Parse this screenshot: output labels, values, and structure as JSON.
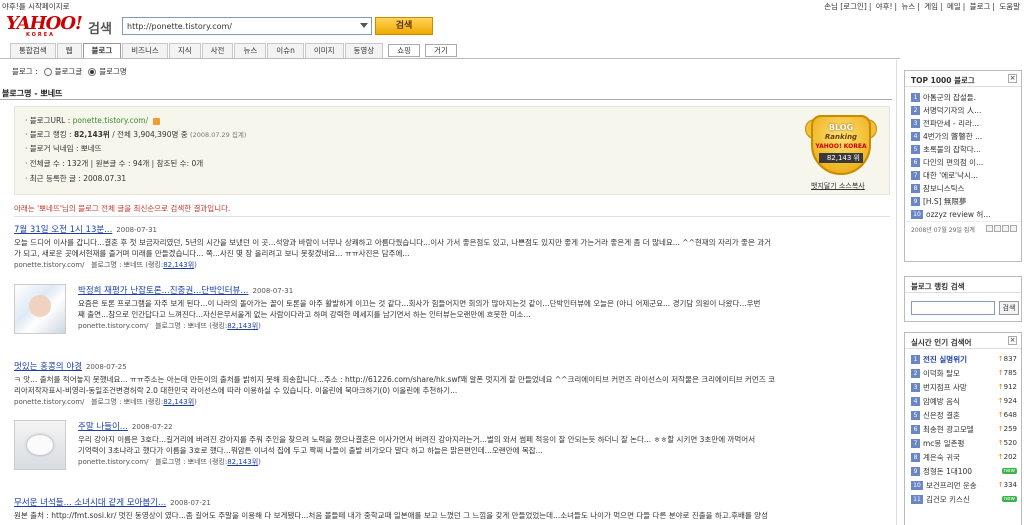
{
  "util": {
    "left_text": "야후!를 시작페이지로",
    "right_items": [
      "손님 [로그인]",
      "야후!",
      "뉴스",
      "게임",
      "메일",
      "블로그",
      "도움말"
    ]
  },
  "header": {
    "logo_text": "YAHOO!",
    "logo_sub": "KOREA",
    "search_label": "검색",
    "search_value": "http://ponette.tistory.com/",
    "search_button": "검색"
  },
  "tabs": [
    "통합검색",
    "웹",
    "블로그",
    "비즈니스",
    "지식",
    "사전",
    "뉴스",
    "이슈n",
    "이미지",
    "동영상",
    "쇼핑",
    "거기"
  ],
  "radio": {
    "label": "블로그 :",
    "opt1": "블로그글",
    "opt2": "블로그명"
  },
  "section_title": "블로그명 - 뽀네뜨",
  "info": {
    "url_label": "블로그URL :",
    "url": "ponette.tistory.com/",
    "rank_label": "블로그 랭킹 :",
    "rank_value": "82,143위",
    "rank_total": "/ 전체 3,904,390명 중",
    "rank_date": "(2008.07.29 집계)",
    "nick_label": "블로거 닉네임 :",
    "nick": "뽀네뜨",
    "counts": "전체글 수 : 132개 | 원본글 수 : 94개 | 참조된 수: 0개",
    "last_label": "최근 등록한 글 :",
    "last_date": "2008.07.31",
    "badge_top": "BLOG",
    "badge_mid": "Ranking",
    "badge_logo": "YAHOO! KOREA",
    "badge_value": "82,143 위",
    "badge_source": "뱃지달기 소스복사"
  },
  "notice": "아래는 '뽀네뜨'님의 블로그 전체 글을 최신순으로 검색한 결과입니다.",
  "results": [
    {
      "title": "7월 31일 오전 1시 13분...",
      "date": "2008-07-31",
      "body1": "오늘 드디어 이사를 갑니다...결혼 후 첫 보금자리였던, 5년의 시간을 보냈던 이 곳...석양과 바람이 너무나 상쾌하고 아름다웠습니다...이사 가서 좋은점도 있고, 나쁜점도 있지만 좋게 가는거라 좋은게 좀 더 많네요... ^^현재의 자리가 좋은 과거",
      "body2": "가 되고, 새로운 곳에서현재를 즐거며 미래를 만들겠습니다... 쪽...사진 몇 장 올리려고 보니 못찾겠네요... ㅠㅠ사진은 담주에...",
      "source": "ponette.tistory.com/",
      "blog": "블로그명 : 뽀네뜨",
      "rank": "82,143위"
    },
    {
      "title": "박정희 재평가 난잡토론...진중권...단박인터뷰...",
      "date": "2008-07-31",
      "body1": "요즘은 토론 프로그램을 자주 보게 된다...이 나라의 돌아가는 꼴이 토론을 아주 활발하게 이끄는 것 같다...회사가 힘들어지면 회의가 많아지는것 같이...단박인터뷰에 오늘은 (아니 어제군요... 경기담 의원이 나왔다...우번",
      "body2": "째 출연...참으로 인간답다고 느껴진다...자신은무서울게 없는 사람이다라고 하며 강력한 메세지를 남기면서 하는 인터뷰는오랜만에 흐뭇한 미소...",
      "source": "ponette.tistory.com/",
      "blog": "블로그명 : 뽀네뜨",
      "rank": "82,143위"
    },
    {
      "title": "멋있는 홍콩의 야경",
      "date": "2008-07-25",
      "body1": "ㅋ 앗... 출처를 적어놓지 못했네요... ㅠㅠ주소는 아는데 만든이의 출처를 밝히지 못해 죄송합니다...주소 : http://61226.com/share/hk.swf꽤 알폰 멋지게 잘 만들었네요 ^^크리에이티브 커먼즈 라이선스이 저작물은 크리에이티브 커먼즈 코",
      "body2": "리아저작자표시-비영리-동일조건변경허락 2.0 대한민국 라이선스에 따라 이용하실 수 있습니다. 이올린에 북마크하기(0) 이올린에 추천하기...",
      "source": "ponette.tistory.com/",
      "blog": "블로그명 : 뽀네뜨",
      "rank": "82,143위"
    },
    {
      "title": "주말 나들이...",
      "date": "2008-07-22",
      "body1": "우리 강아지 이름은 3호다...길거리에 버려진 강아지를 주워 주인을 찾으려 노력을 했으나결혼은 이사가면서 버려진 강아지라는거...벌의 와서 썸페 적응이 잘 안되는듯 하더니 잘 논다... ㅎㅎ할 시키면 3초만에 까먹어서",
      "body2": "기억력이 3초냐라고 했다가 이름을 3호로 했다...뭐암튼 이녀석 집에 두고 짝쩌 나들이 출발 비가오다 말다 하고 하늘은 맑은편인데...오랜만에 복잡...",
      "source": "ponette.tistory.com/",
      "blog": "블로그명 : 뽀네뜨",
      "rank": "82,143위"
    },
    {
      "title": "무서운 녀석들... 소녀시대 같게 모아봅기...",
      "date": "2008-07-21",
      "body1": "원본 출처 : http://fmt.sosi.kr/ 멋진 동영상이 였다...좀 길어도 주말을 이용해 다 보게됐다...처음 볼들떼 내가 중학교때 일본애를 보고 느꼈던 그 느낌을 갖게 만들었었는데...소녀들도 나이가 먹으면 다들 다른 분야로 진출을 하고.후배를 양성"
    }
  ],
  "sidebar": {
    "top_title": "TOP 1000 블로그",
    "top_items": [
      {
        "n": "1",
        "t": "아톰군의 잡설들."
      },
      {
        "n": "2",
        "t": "서명덕기자의 人..."
      },
      {
        "n": "3",
        "t": "전파만세 - 리라..."
      },
      {
        "n": "4",
        "t": "4번가의 瞥瞥한 ..."
      },
      {
        "n": "5",
        "t": "초록불의 잡학다..."
      },
      {
        "n": "6",
        "t": "다인의 편의점 이..."
      },
      {
        "n": "7",
        "t": "대한 '에로'낙시..."
      },
      {
        "n": "8",
        "t": "잠보니스틱스"
      },
      {
        "n": "9",
        "t": "[H.S] 無限夢"
      },
      {
        "n": "10",
        "t": "ozzyz review 허..."
      }
    ],
    "top_foot": "2008년 07월 29일 집계",
    "rank_title": "블로그 랭킹 검색",
    "rank_button": "검색",
    "rt_title": "실시간 인기 검색어",
    "rt_items": [
      {
        "n": "1",
        "t": "전진 실명위기",
        "c": "837",
        "strong": true
      },
      {
        "n": "2",
        "t": "이덕화 탈모",
        "c": "785"
      },
      {
        "n": "3",
        "t": "번지점프 사망",
        "c": "912"
      },
      {
        "n": "4",
        "t": "암예방 음식",
        "c": "924"
      },
      {
        "n": "5",
        "t": "신은정 결혼",
        "c": "648"
      },
      {
        "n": "6",
        "t": "최송현 광고모델",
        "c": "259"
      },
      {
        "n": "7",
        "t": "mc몽 일촌평",
        "c": "520"
      },
      {
        "n": "8",
        "t": "계은숙 귀국",
        "c": "202"
      },
      {
        "n": "9",
        "t": "정형돈 1대100",
        "c": "new"
      },
      {
        "n": "10",
        "t": "보건프리먼 운송",
        "c": "334"
      },
      {
        "n": "11",
        "t": "김건모 키스신",
        "c": "new"
      }
    ]
  }
}
